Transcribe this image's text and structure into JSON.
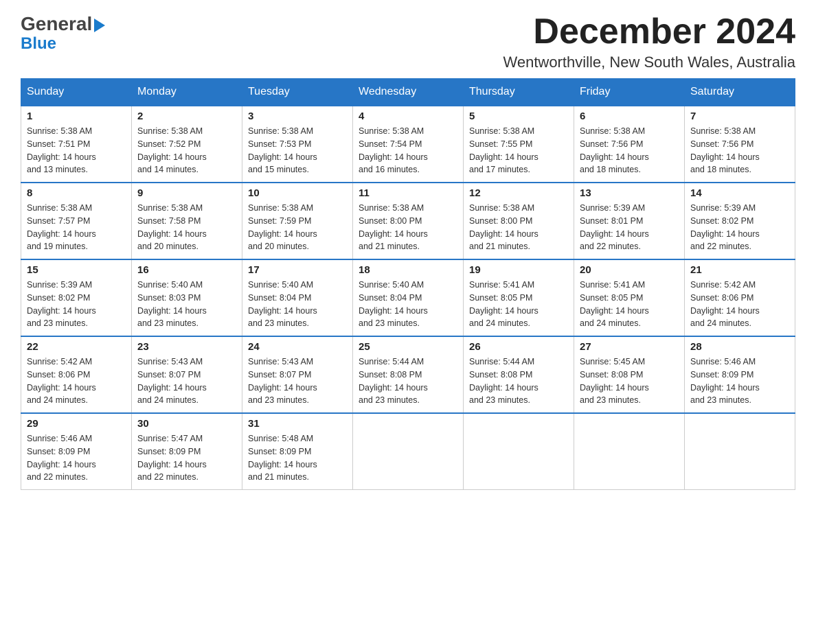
{
  "header": {
    "logo_general": "General",
    "logo_blue": "Blue",
    "month_title": "December 2024",
    "location": "Wentworthville, New South Wales, Australia"
  },
  "days_of_week": [
    "Sunday",
    "Monday",
    "Tuesday",
    "Wednesday",
    "Thursday",
    "Friday",
    "Saturday"
  ],
  "weeks": [
    [
      {
        "day": "1",
        "sunrise": "5:38 AM",
        "sunset": "7:51 PM",
        "daylight": "14 hours and 13 minutes."
      },
      {
        "day": "2",
        "sunrise": "5:38 AM",
        "sunset": "7:52 PM",
        "daylight": "14 hours and 14 minutes."
      },
      {
        "day": "3",
        "sunrise": "5:38 AM",
        "sunset": "7:53 PM",
        "daylight": "14 hours and 15 minutes."
      },
      {
        "day": "4",
        "sunrise": "5:38 AM",
        "sunset": "7:54 PM",
        "daylight": "14 hours and 16 minutes."
      },
      {
        "day": "5",
        "sunrise": "5:38 AM",
        "sunset": "7:55 PM",
        "daylight": "14 hours and 17 minutes."
      },
      {
        "day": "6",
        "sunrise": "5:38 AM",
        "sunset": "7:56 PM",
        "daylight": "14 hours and 18 minutes."
      },
      {
        "day": "7",
        "sunrise": "5:38 AM",
        "sunset": "7:56 PM",
        "daylight": "14 hours and 18 minutes."
      }
    ],
    [
      {
        "day": "8",
        "sunrise": "5:38 AM",
        "sunset": "7:57 PM",
        "daylight": "14 hours and 19 minutes."
      },
      {
        "day": "9",
        "sunrise": "5:38 AM",
        "sunset": "7:58 PM",
        "daylight": "14 hours and 20 minutes."
      },
      {
        "day": "10",
        "sunrise": "5:38 AM",
        "sunset": "7:59 PM",
        "daylight": "14 hours and 20 minutes."
      },
      {
        "day": "11",
        "sunrise": "5:38 AM",
        "sunset": "8:00 PM",
        "daylight": "14 hours and 21 minutes."
      },
      {
        "day": "12",
        "sunrise": "5:38 AM",
        "sunset": "8:00 PM",
        "daylight": "14 hours and 21 minutes."
      },
      {
        "day": "13",
        "sunrise": "5:39 AM",
        "sunset": "8:01 PM",
        "daylight": "14 hours and 22 minutes."
      },
      {
        "day": "14",
        "sunrise": "5:39 AM",
        "sunset": "8:02 PM",
        "daylight": "14 hours and 22 minutes."
      }
    ],
    [
      {
        "day": "15",
        "sunrise": "5:39 AM",
        "sunset": "8:02 PM",
        "daylight": "14 hours and 23 minutes."
      },
      {
        "day": "16",
        "sunrise": "5:40 AM",
        "sunset": "8:03 PM",
        "daylight": "14 hours and 23 minutes."
      },
      {
        "day": "17",
        "sunrise": "5:40 AM",
        "sunset": "8:04 PM",
        "daylight": "14 hours and 23 minutes."
      },
      {
        "day": "18",
        "sunrise": "5:40 AM",
        "sunset": "8:04 PM",
        "daylight": "14 hours and 23 minutes."
      },
      {
        "day": "19",
        "sunrise": "5:41 AM",
        "sunset": "8:05 PM",
        "daylight": "14 hours and 24 minutes."
      },
      {
        "day": "20",
        "sunrise": "5:41 AM",
        "sunset": "8:05 PM",
        "daylight": "14 hours and 24 minutes."
      },
      {
        "day": "21",
        "sunrise": "5:42 AM",
        "sunset": "8:06 PM",
        "daylight": "14 hours and 24 minutes."
      }
    ],
    [
      {
        "day": "22",
        "sunrise": "5:42 AM",
        "sunset": "8:06 PM",
        "daylight": "14 hours and 24 minutes."
      },
      {
        "day": "23",
        "sunrise": "5:43 AM",
        "sunset": "8:07 PM",
        "daylight": "14 hours and 24 minutes."
      },
      {
        "day": "24",
        "sunrise": "5:43 AM",
        "sunset": "8:07 PM",
        "daylight": "14 hours and 23 minutes."
      },
      {
        "day": "25",
        "sunrise": "5:44 AM",
        "sunset": "8:08 PM",
        "daylight": "14 hours and 23 minutes."
      },
      {
        "day": "26",
        "sunrise": "5:44 AM",
        "sunset": "8:08 PM",
        "daylight": "14 hours and 23 minutes."
      },
      {
        "day": "27",
        "sunrise": "5:45 AM",
        "sunset": "8:08 PM",
        "daylight": "14 hours and 23 minutes."
      },
      {
        "day": "28",
        "sunrise": "5:46 AM",
        "sunset": "8:09 PM",
        "daylight": "14 hours and 23 minutes."
      }
    ],
    [
      {
        "day": "29",
        "sunrise": "5:46 AM",
        "sunset": "8:09 PM",
        "daylight": "14 hours and 22 minutes."
      },
      {
        "day": "30",
        "sunrise": "5:47 AM",
        "sunset": "8:09 PM",
        "daylight": "14 hours and 22 minutes."
      },
      {
        "day": "31",
        "sunrise": "5:48 AM",
        "sunset": "8:09 PM",
        "daylight": "14 hours and 21 minutes."
      },
      null,
      null,
      null,
      null
    ]
  ],
  "labels": {
    "sunrise": "Sunrise:",
    "sunset": "Sunset:",
    "daylight": "Daylight:"
  }
}
